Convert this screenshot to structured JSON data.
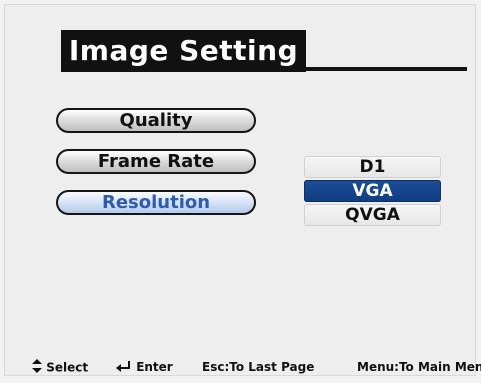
{
  "title": "Image Setting",
  "menu_items": [
    {
      "label": "Quality"
    },
    {
      "label": "Frame Rate"
    },
    {
      "label": "Resolution"
    }
  ],
  "resolution_options": [
    {
      "label": "D1"
    },
    {
      "label": "VGA"
    },
    {
      "label": "QVGA"
    }
  ],
  "footer": {
    "select_label": "Select",
    "enter_label": "Enter",
    "esc_label": "Esc:To Last Page",
    "menu_label": "Menu:To Main Menu"
  },
  "icons": {
    "select": "up-down-arrow-icon",
    "enter": "enter-arrow-icon"
  },
  "colors": {
    "title_background": "#111111",
    "active_text": "#2e5cae",
    "selected_option": "#1b4d95"
  }
}
